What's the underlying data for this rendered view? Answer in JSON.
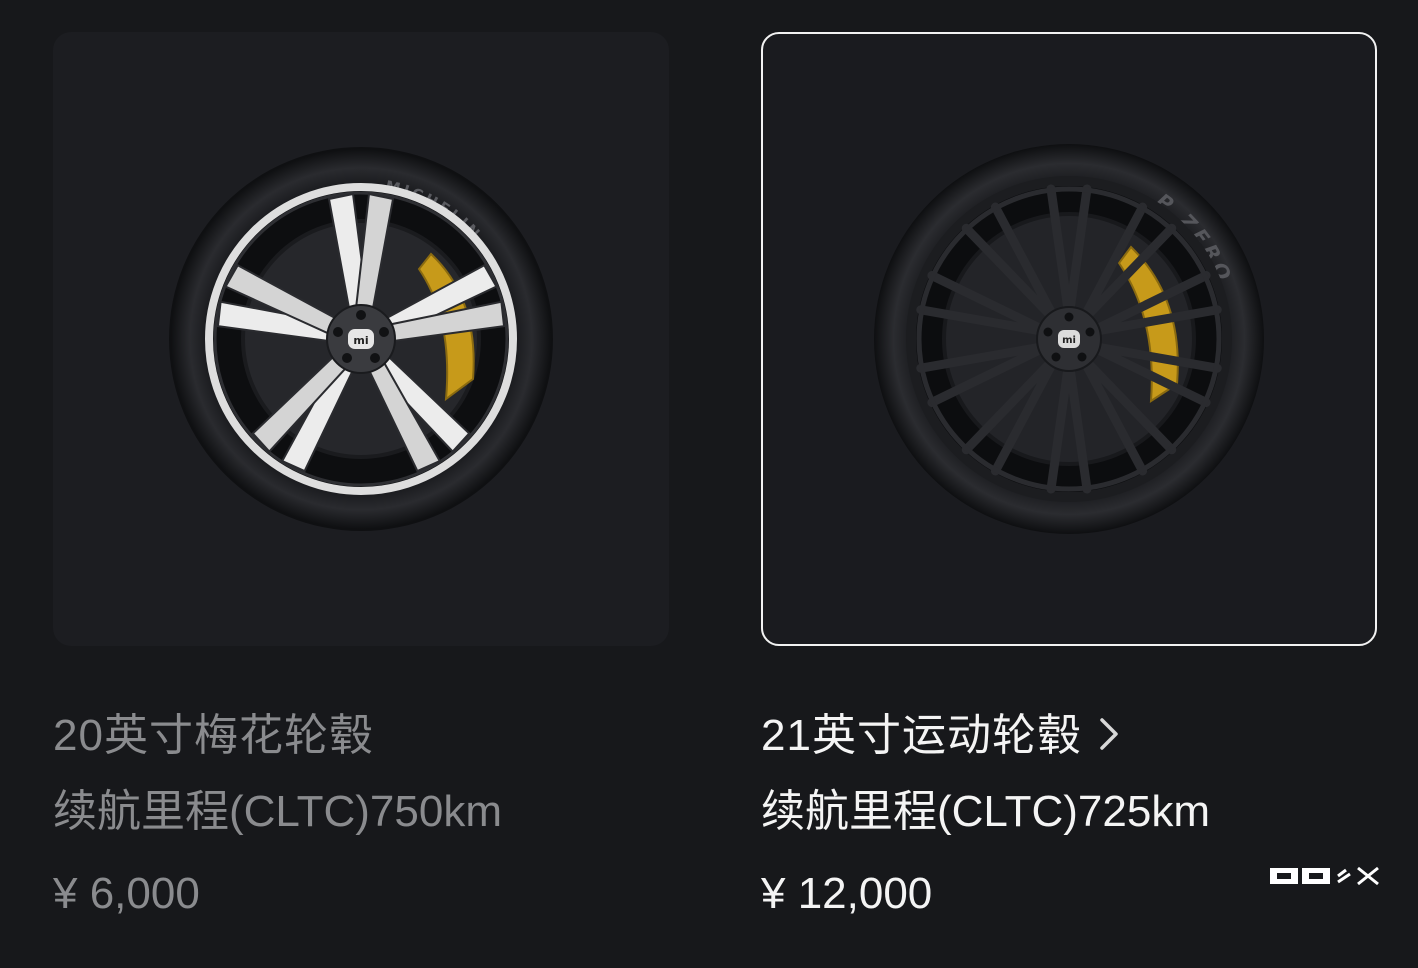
{
  "options": [
    {
      "title": "20英寸梅花轮毂",
      "range": "续航里程(CLTC)750km",
      "price": "¥ 6,000",
      "selected": false,
      "tire_brand": "MICHELIN"
    },
    {
      "title": "21英寸运动轮毂",
      "range": "续航里程(CLTC)725km",
      "price": "¥ 12,000",
      "selected": true,
      "tire_brand": "P ZERO"
    }
  ],
  "hub_logo": "mi",
  "icons": {
    "chevron": "chevron-right-icon"
  },
  "colors": {
    "background": "#17181b",
    "selected_border": "#f2f2f2",
    "dim_text": "#8a8b8e",
    "bright_text": "#f4f4f4",
    "caliper": "#c79a1a"
  }
}
